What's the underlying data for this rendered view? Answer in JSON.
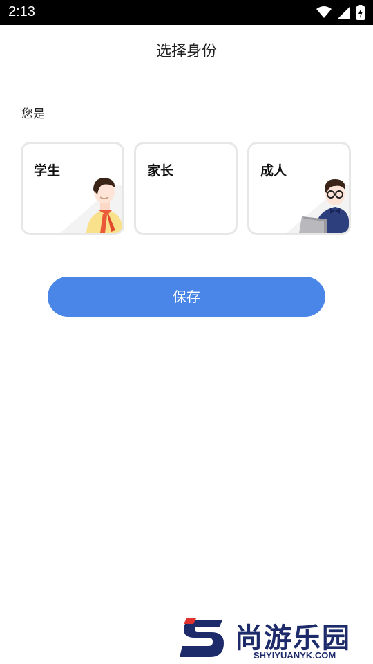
{
  "status_bar": {
    "time": "2:13"
  },
  "header": {
    "title": "选择身份"
  },
  "question": "您是",
  "identity_options": [
    {
      "label": "学生"
    },
    {
      "label": "家长"
    },
    {
      "label": "成人"
    }
  ],
  "save_button": {
    "label": "保存"
  },
  "watermark": {
    "brand_cn": "尚游乐园",
    "brand_en": "SHYIYUANYK.COM"
  },
  "colors": {
    "accent": "#4a86e8",
    "card_border": "#e7e7e7",
    "watermark": "#1d2b6b"
  }
}
